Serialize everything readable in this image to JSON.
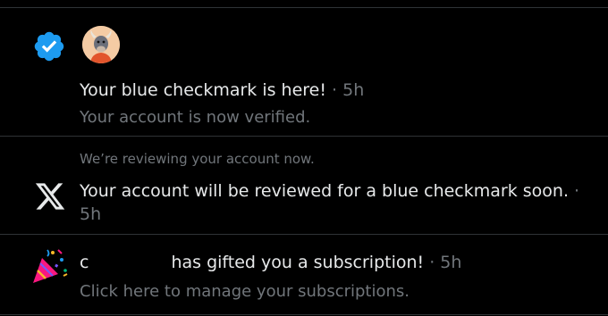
{
  "notifications": [
    {
      "title": "Your blue checkmark is here!",
      "separator": " · ",
      "time": "5h",
      "subtitle": "Your account is now verified."
    },
    {
      "context": "We’re reviewing your account now.",
      "title": "Your account will be reviewed for a blue checkmark soon.",
      "separator": " ·",
      "time": "5h"
    },
    {
      "name_prefix": "c",
      "title": "has gifted you a subscription!",
      "separator": " · ",
      "time": "5h",
      "subtitle": "Click here to manage your subscriptions."
    }
  ],
  "colors": {
    "background": "#000000",
    "primary_text": "#e7e9ea",
    "secondary_text": "#71767b",
    "divider": "#2f3336",
    "verified_badge": "#1d9bf0"
  },
  "icons": {
    "n1": "verified-badge-icon",
    "n1_avatar": "bull-avatar",
    "n2": "x-logo-icon",
    "n3": "party-popper-icon"
  }
}
